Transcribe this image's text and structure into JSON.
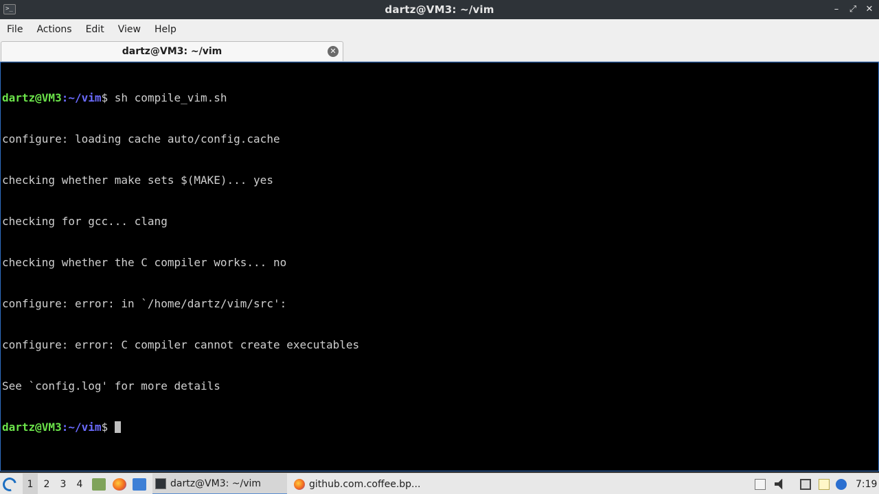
{
  "window": {
    "title": "dartz@VM3: ~/vim",
    "app_icon": ">_",
    "controls": [
      "–",
      "⤢",
      "✕"
    ]
  },
  "menu": [
    "File",
    "Actions",
    "Edit",
    "View",
    "Help"
  ],
  "tab": {
    "label": "dartz@VM3: ~/vim",
    "close_icon": "✕"
  },
  "terminal": {
    "prompt_user": "dartz@VM3",
    "prompt_path": ":~/vim",
    "prompt_symbol": "$",
    "command": " sh compile_vim.sh",
    "output": [
      "configure: loading cache auto/config.cache",
      "checking whether make sets $(MAKE)... yes",
      "checking for gcc... clang",
      "checking whether the C compiler works... no",
      "configure: error: in `/home/dartz/vim/src':",
      "configure: error: C compiler cannot create executables",
      "See `config.log' for more details"
    ]
  },
  "taskbar": {
    "desktops": [
      "1",
      "2",
      "3",
      "4"
    ],
    "tasks": [
      {
        "label": "dartz@VM3: ~/vim",
        "icon": "terminal-icon"
      },
      {
        "label": "github.com.coffee.bp...",
        "icon": "firefox-icon"
      }
    ],
    "clock": "7:19"
  },
  "colors": {
    "prompt_user": "#6be34a",
    "prompt_path": "#6b6bff",
    "terminal_bg": "#000000",
    "frame_accent": "#2f6fc4"
  }
}
